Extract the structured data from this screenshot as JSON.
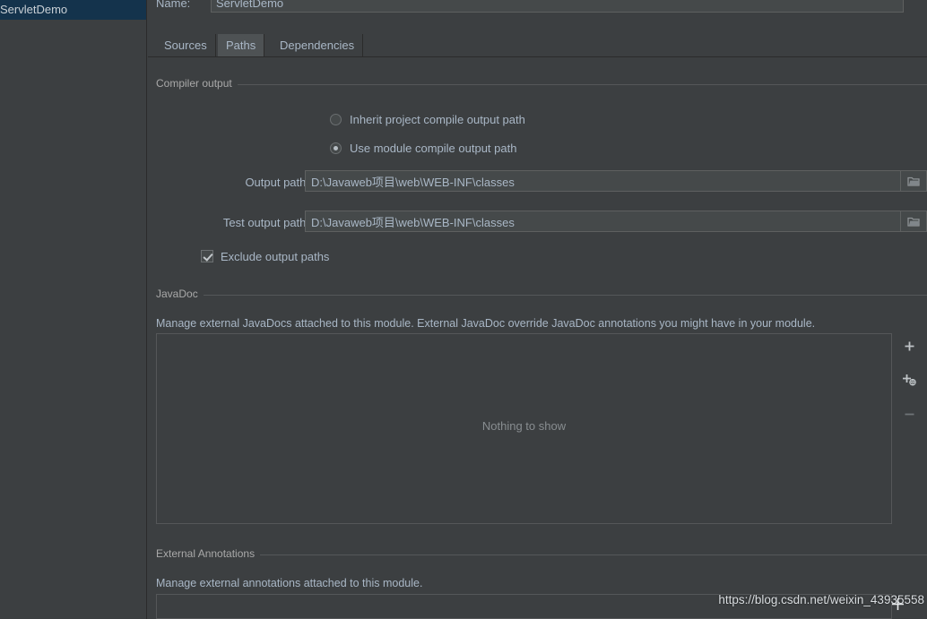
{
  "sidebar": {
    "items": [
      {
        "label": "ServletDemo",
        "selected": true
      }
    ]
  },
  "name_row": {
    "label": "Name:",
    "value": "ServletDemo"
  },
  "tabs": [
    {
      "label": "Sources",
      "active": false
    },
    {
      "label": "Paths",
      "active": true
    },
    {
      "label": "Dependencies",
      "active": false
    }
  ],
  "compiler_output": {
    "group_title": "Compiler output",
    "radio_inherit": {
      "label": "Inherit project compile output path",
      "checked": false
    },
    "radio_module": {
      "label": "Use module compile output path",
      "checked": true
    },
    "output_path": {
      "label": "Output path:",
      "value": "D:\\Javaweb项目\\web\\WEB-INF\\classes",
      "browse_icon": "folder-icon"
    },
    "test_output_path": {
      "label": "Test output path:",
      "value": "D:\\Javaweb项目\\web\\WEB-INF\\classes",
      "browse_icon": "folder-icon"
    },
    "exclude_checkbox": {
      "label": "Exclude output paths",
      "checked": true
    }
  },
  "javadoc": {
    "group_title": "JavaDoc",
    "description": "Manage external JavaDocs attached to this module. External JavaDoc override JavaDoc annotations you might have in your module.",
    "empty_text": "Nothing to show",
    "toolbar": [
      {
        "name": "add-javadoc-button",
        "icon": "plus-icon",
        "enabled": true
      },
      {
        "name": "specify-javadoc-url-button",
        "icon": "plus-globe-icon",
        "enabled": true
      },
      {
        "name": "remove-javadoc-button",
        "icon": "minus-icon",
        "enabled": false
      }
    ]
  },
  "external_annotations": {
    "group_title": "External Annotations",
    "description": "Manage external annotations attached to this module."
  },
  "watermark": {
    "text": "https://blog.csdn.net/weixin_43935558"
  },
  "colors": {
    "background": "#3c3f41",
    "selection": "#14334c",
    "text": "#a9b7c6",
    "field_background": "#45494a",
    "border": "#555759",
    "tab_active": "#4e5254"
  }
}
